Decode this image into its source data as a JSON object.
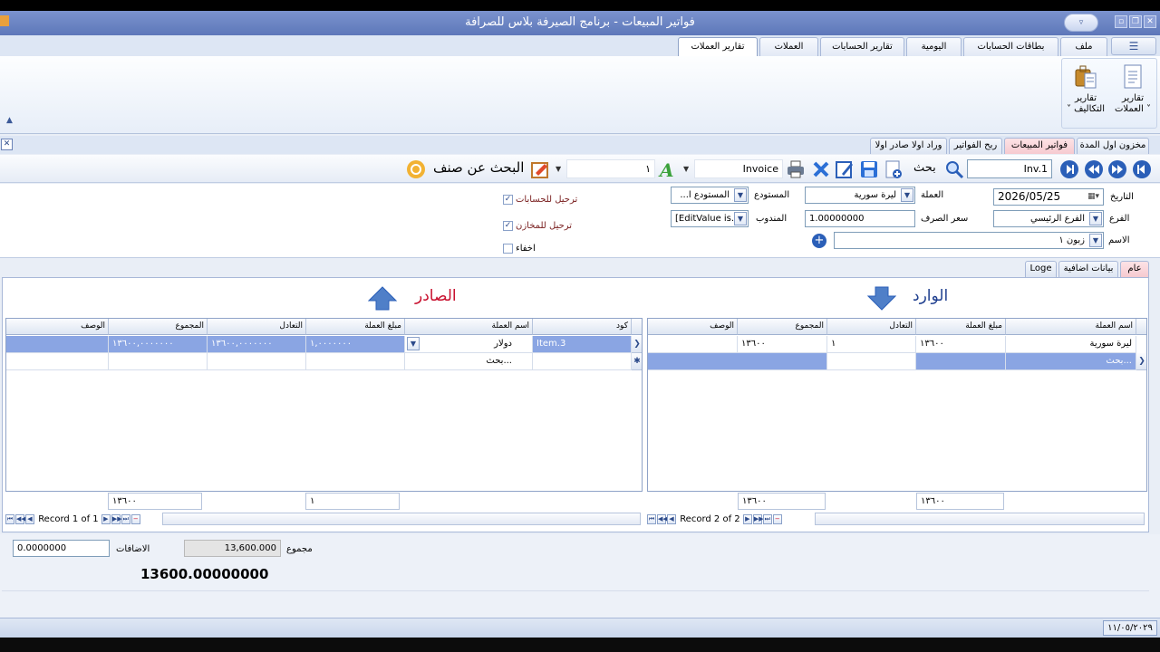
{
  "window": {
    "title": "فواتير المبيعات - برنامج الصيرفة بلاس للصرافة"
  },
  "ribbon": {
    "tabs": [
      "ملف",
      "بطاقات الحسابات",
      "اليومية",
      "تقارير الحسابات",
      "العملات",
      "تقارير العملات"
    ],
    "active_tab": "تقارير العملات",
    "buttons": [
      {
        "label1": "تقارير",
        "label2": "العملات ˅"
      },
      {
        "label1": "تقارير",
        "label2": "˅ التكاليف"
      }
    ]
  },
  "doc_tabs": [
    "مخزون اول المدة",
    "فواتير المبيعات",
    "ربح الفواتير",
    "وراد اولا صادر اولا"
  ],
  "active_doc_tab": "فواتير المبيعات",
  "toolbar": {
    "invoice_number": "Inv.1",
    "search_label": "بحث",
    "invoice_label": "Invoice",
    "count_value": "١",
    "item_search_label": "البحث عن صنف"
  },
  "form": {
    "date_label": "التاريخ",
    "date_value": "2026/05/25",
    "branch_label": "الفرع",
    "branch_value": "الفرع الرئيسي",
    "name_label": "الاسم",
    "name_value": "زبون ١",
    "currency_label": "العملة",
    "currency_value": "ليرة سورية",
    "rate_label": "سعر الصرف",
    "rate_value": "1.00000000",
    "warehouse_label": "المستودع",
    "warehouse_value": "...المستودع ا",
    "rep_label": "المندوب",
    "rep_value": "[EditValue is...",
    "post_accounts": "ترحيل للحسابات",
    "post_stores": "ترحيل للمخازن",
    "hide": "اخفاء"
  },
  "sub_tabs": [
    "عام",
    "بيانات اضافية",
    "Loge"
  ],
  "active_sub_tab": "عام",
  "incoming": {
    "title": "الوارد",
    "columns": [
      "اسم العملة",
      "مبلغ العملة",
      "التعادل",
      "المجموع",
      "الوصف"
    ],
    "rows": [
      [
        "ليرة سورية",
        "١٣٦٠٠",
        "١",
        "١٣٦٠٠",
        ""
      ]
    ],
    "new_row_text": "بحث...",
    "footer": [
      "١٣٦٠٠",
      "١٣٦٠٠"
    ],
    "record_text": "Record 2 of 2"
  },
  "outgoing": {
    "title": "الصادر",
    "columns": [
      "كود",
      "اسم العملة",
      "مبلغ العملة",
      "التعادل",
      "المجموع",
      "الوصف"
    ],
    "rows": [
      [
        "Item.3",
        "دولار",
        "١,٠٠٠٠٠٠٠",
        "١٣٦٠٠,٠٠٠٠٠٠٠",
        "١٣٦٠٠,٠٠٠٠٠٠٠",
        ""
      ]
    ],
    "new_row_text": "بحث...",
    "footer": [
      "١",
      "١٣٦٠٠"
    ],
    "record_text": "Record 1 of 1"
  },
  "totals": {
    "sum_label": "مجموع",
    "sum_value": "13,600.000",
    "additions_label": "الاضافات",
    "additions_value": "0.0000000",
    "grand_total": "13600.00000000"
  },
  "status": {
    "date": "١١/٠٥/٢٠٢٩"
  },
  "colors": {
    "titlebar": "#5d77b9",
    "selection": "#8aa5e3",
    "title_red": "#c8102e",
    "title_blue": "#1f3f8f"
  }
}
